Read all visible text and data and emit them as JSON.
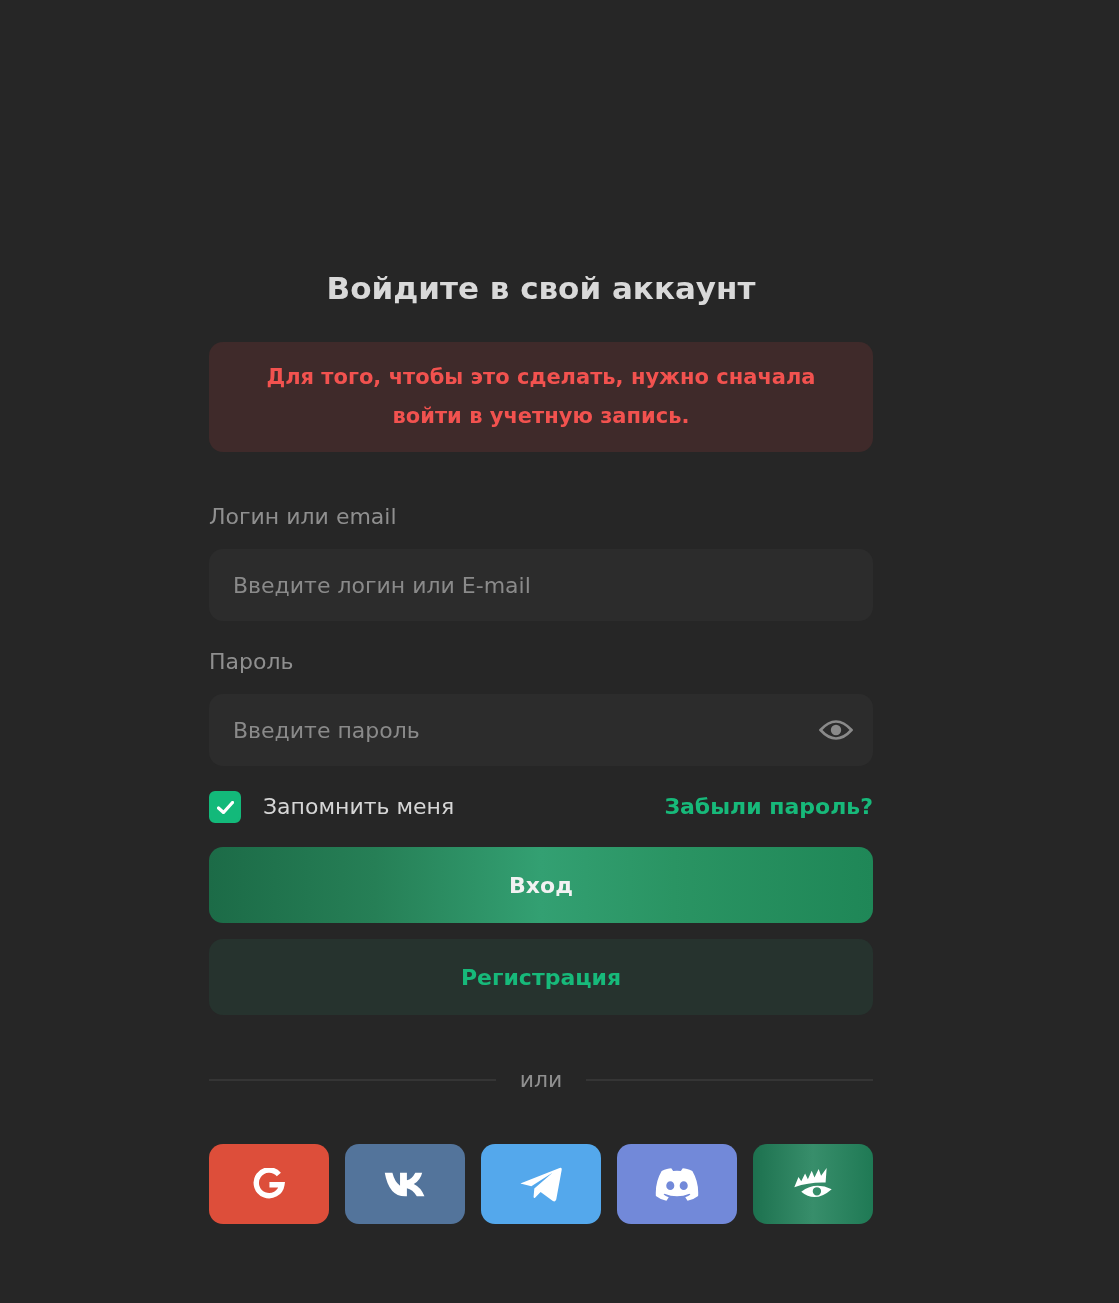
{
  "title": "Войдите в свой аккаунт",
  "alert": {
    "text": "Для того, чтобы это сделать, нужно сначала войти в учетную запись."
  },
  "fields": [
    {
      "kind": "text",
      "label": "Логин или email",
      "placeholder": "Введите логин или E-mail"
    },
    {
      "kind": "password",
      "label": "Пароль",
      "placeholder": "Введите пароль"
    }
  ],
  "remember": {
    "label": "Запомнить меня",
    "checked": true
  },
  "forgot_link": "Забыли пароль?",
  "buttons": [
    {
      "kind": "primary",
      "label": "Вход"
    },
    {
      "kind": "secondary",
      "label": "Регистрация"
    }
  ],
  "divider": "или",
  "social": [
    {
      "kind": "google",
      "color": "#dd4e3a"
    },
    {
      "kind": "vk",
      "color": "#53749b"
    },
    {
      "kind": "telegram",
      "color": "#54a8ec"
    },
    {
      "kind": "discord",
      "color": "#7289d9"
    },
    {
      "kind": "eye",
      "color": "#21815a"
    }
  ]
}
